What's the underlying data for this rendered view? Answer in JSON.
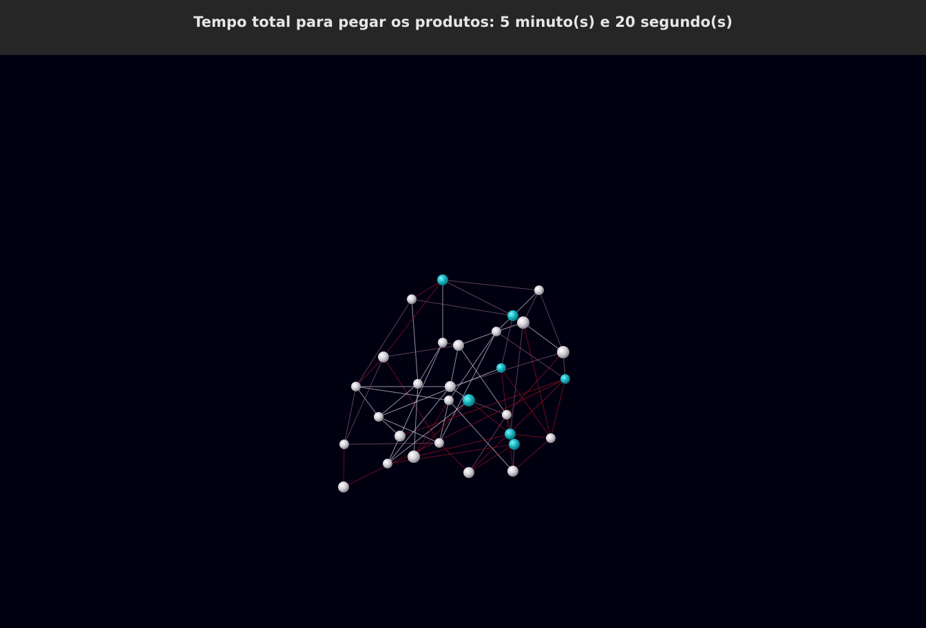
{
  "header": {
    "title": "Tempo total para pegar os produtos: 5 minuto(s) e 20 segundo(s)"
  },
  "colors": {
    "background": "#000010",
    "header_bg": "#262626",
    "node_default": "#d8d4dc",
    "node_product": "#1bb9c4",
    "edge_light": "#c8c0d8",
    "edge_mid": "#8a5a7a",
    "edge_red": "#8a1020"
  },
  "legend_icons": {
    "node_default": "gray-sphere",
    "node_product": "cyan-sphere"
  }
}
